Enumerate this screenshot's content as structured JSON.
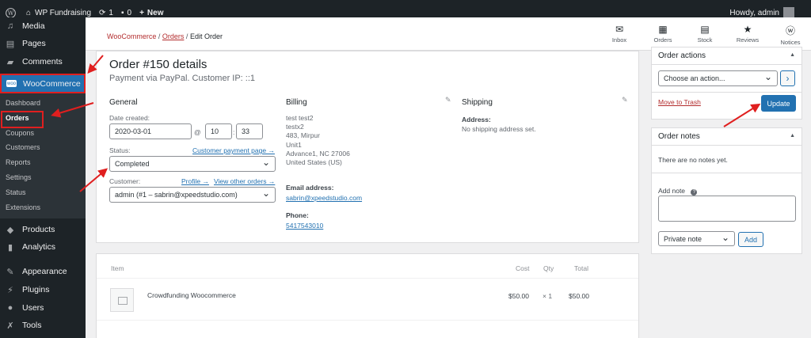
{
  "adminbar": {
    "site_name": "WP Fundraising",
    "updates_count": "1",
    "comments_count": "0",
    "new_label": "New",
    "howdy": "Howdy, admin"
  },
  "sidebar": {
    "items_top": [
      {
        "label": "Media",
        "icon": "media-icon"
      },
      {
        "label": "Pages",
        "icon": "pages-icon"
      },
      {
        "label": "Comments",
        "icon": "comments-icon"
      }
    ],
    "woocommerce_label": "WooCommerce",
    "submenu": [
      "Dashboard",
      "Orders",
      "Coupons",
      "Customers",
      "Reports",
      "Settings",
      "Status",
      "Extensions"
    ],
    "items_bottom": [
      {
        "label": "Products",
        "icon": "products-icon"
      },
      {
        "label": "Analytics",
        "icon": "analytics-icon"
      },
      {
        "label": "Appearance",
        "icon": "appearance-icon"
      },
      {
        "label": "Plugins",
        "icon": "plugins-icon"
      },
      {
        "label": "Users",
        "icon": "users-icon"
      },
      {
        "label": "Tools",
        "icon": "tools-icon"
      }
    ]
  },
  "breadcrumb": {
    "woocommerce": "WooCommerce",
    "orders": "Orders",
    "current": "Edit Order"
  },
  "topicons": [
    {
      "label": "Inbox",
      "icon": "inbox-icon"
    },
    {
      "label": "Orders",
      "icon": "orders-icon"
    },
    {
      "label": "Stock",
      "icon": "stock-icon"
    },
    {
      "label": "Reviews",
      "icon": "reviews-icon"
    },
    {
      "label": "Notices",
      "icon": "notices-icon"
    }
  ],
  "order": {
    "title": "Order #150 details",
    "subtitle": "Payment via PayPal. Customer IP: ::1",
    "general": {
      "heading": "General",
      "date_label": "Date created:",
      "date_value": "2020-03-01",
      "at": "@",
      "hour": "10",
      "minute": "33",
      "status_label": "Status:",
      "customer_payment_link": "Customer payment page →",
      "status_value": "Completed",
      "customer_label": "Customer:",
      "profile_link": "Profile →",
      "view_orders_link": "View other orders →",
      "customer_value": "admin (#1 – sabrin@xpeedstudio.com)"
    },
    "billing": {
      "heading": "Billing",
      "address_lines": [
        "test test2",
        "testx2",
        "483, Mirpur",
        "Unit1",
        "Advance1, NC 27006",
        "United States (US)"
      ],
      "email_label": "Email address:",
      "email": "sabrin@xpeedstudio.com",
      "phone_label": "Phone:",
      "phone": "5417543010"
    },
    "shipping": {
      "heading": "Shipping",
      "address_label": "Address:",
      "address_value": "No shipping address set."
    }
  },
  "items": {
    "headers": {
      "item": "Item",
      "cost": "Cost",
      "qty": "Qty",
      "total": "Total"
    },
    "rows": [
      {
        "name": "Crowdfunding Woocommerce",
        "cost": "$50.00",
        "qty": "× 1",
        "total": "$50.00"
      }
    ]
  },
  "order_actions": {
    "title": "Order actions",
    "select_value": "Choose an action...",
    "go_label": "›",
    "trash_label": "Move to Trash",
    "update_label": "Update"
  },
  "order_notes": {
    "title": "Order notes",
    "empty_text": "There are no notes yet.",
    "add_note_label": "Add note",
    "help_icon": "?",
    "note_type": "Private note",
    "add_button": "Add"
  },
  "colors": {
    "admin_bar": "#1d2327",
    "primary": "#2271b1",
    "annotation_red": "#e01f1f",
    "link_red": "#b32d2e"
  }
}
